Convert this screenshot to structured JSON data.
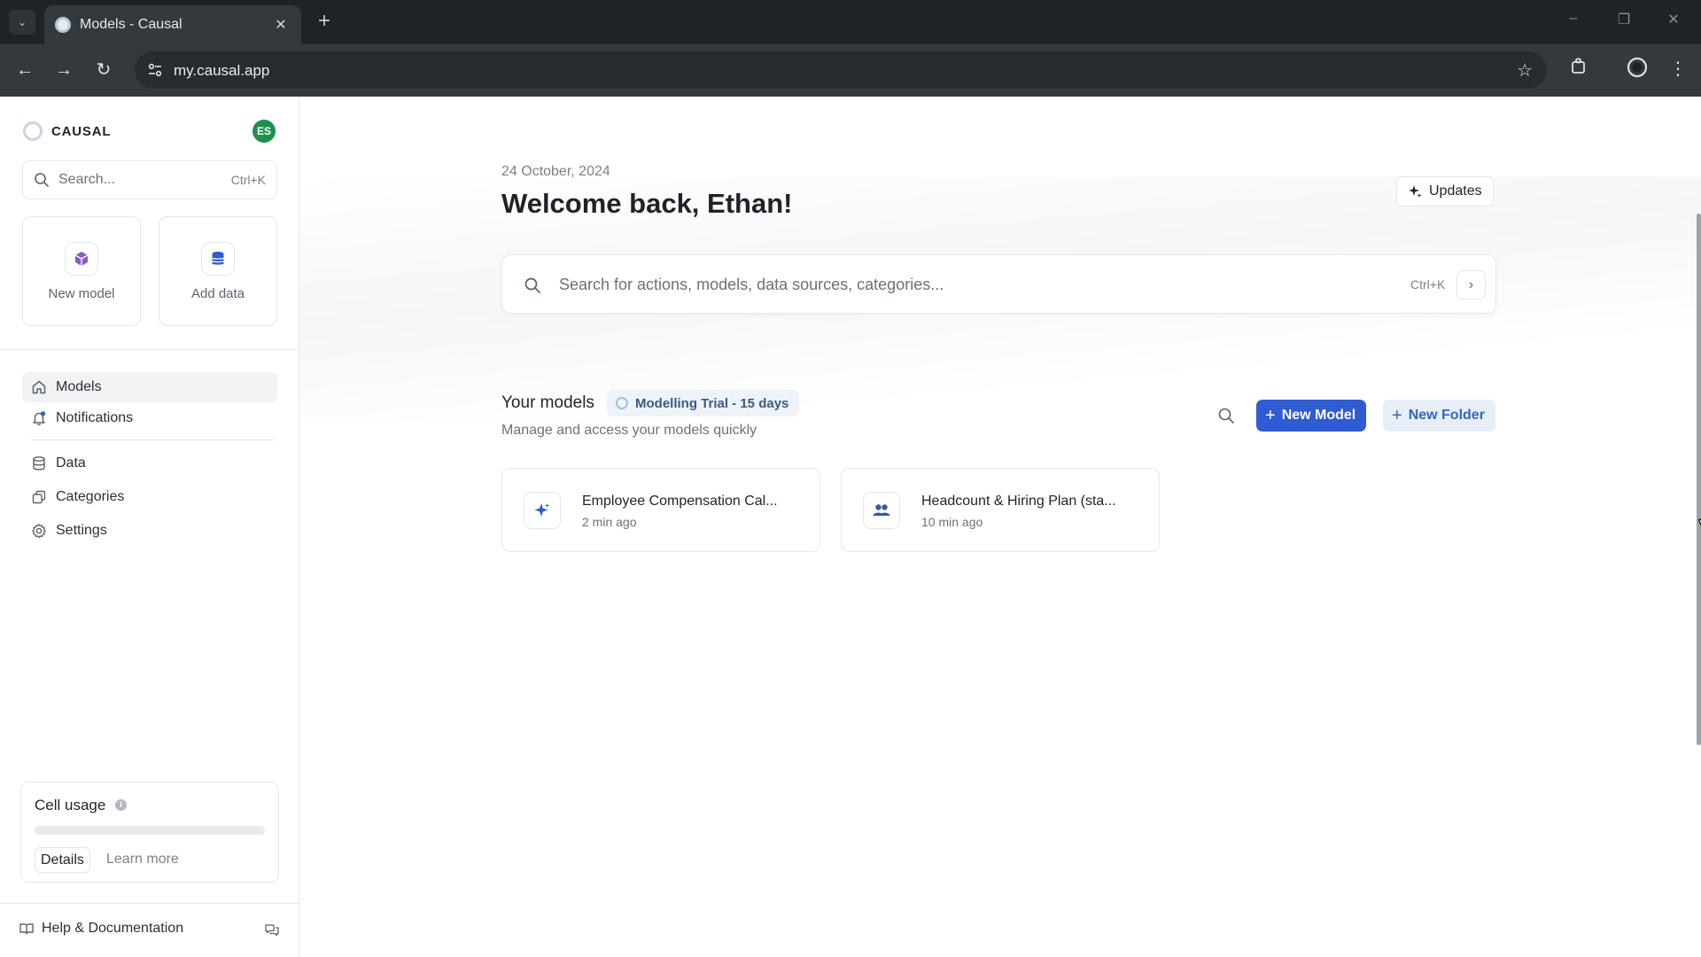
{
  "browser": {
    "tab_title": "Models - Causal",
    "url": "my.causal.app"
  },
  "sidebar": {
    "brand": "CAUSAL",
    "avatar_initials": "ES",
    "search_placeholder": "Search...",
    "search_shortcut": "Ctrl+K",
    "quick_actions": [
      {
        "label": "New model",
        "icon": "cube-icon"
      },
      {
        "label": "Add data",
        "icon": "database-icon"
      }
    ],
    "nav": [
      {
        "label": "Models",
        "icon": "home-icon",
        "active": true
      },
      {
        "label": "Notifications",
        "icon": "bell-icon"
      },
      {
        "label": "Data",
        "icon": "database-icon"
      },
      {
        "label": "Categories",
        "icon": "stack-icon"
      },
      {
        "label": "Settings",
        "icon": "gear-icon"
      }
    ],
    "usage": {
      "title": "Cell usage",
      "details_label": "Details",
      "learn_more_label": "Learn more"
    },
    "help_label": "Help & Documentation"
  },
  "main": {
    "date": "24 October, 2024",
    "welcome": "Welcome back, Ethan!",
    "updates_label": "Updates",
    "search_placeholder": "Search for actions, models, data sources, categories...",
    "search_shortcut": "Ctrl+K",
    "models_title": "Your models",
    "trial_badge": "Modelling Trial - 15 days",
    "models_subtitle": "Manage and access your models quickly",
    "new_model_label": "New Model",
    "new_folder_label": "New Folder",
    "models": [
      {
        "name": "Employee Compensation Cal...",
        "time": "2 min ago",
        "icon": "sparkle-icon"
      },
      {
        "name": "Headcount & Hiring Plan (sta...",
        "time": "10 min ago",
        "icon": "people-icon"
      }
    ]
  },
  "colors": {
    "primary": "#2f5bd3",
    "primary_soft": "#e8eef7",
    "avatar": "#1f8f4e",
    "chrome_dark": "#1f2327"
  }
}
